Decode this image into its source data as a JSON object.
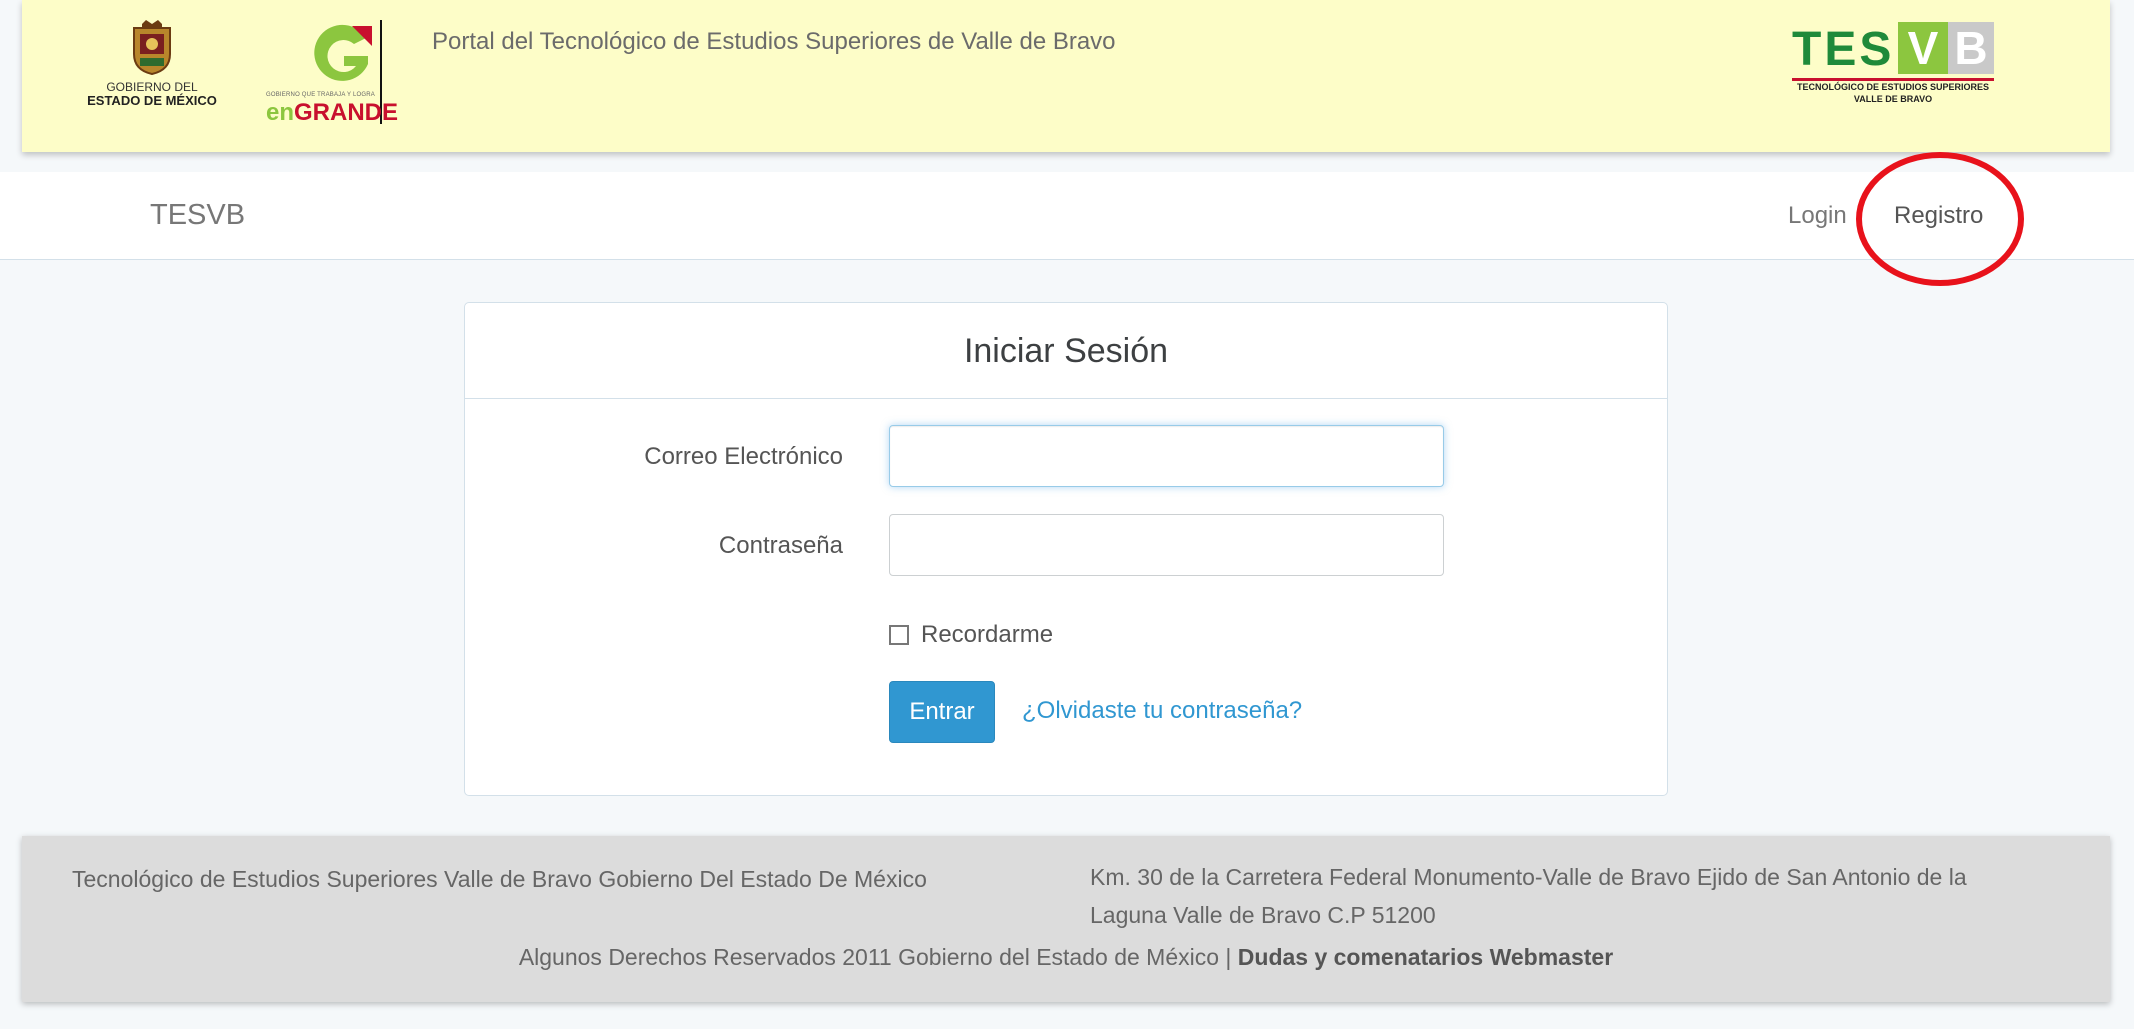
{
  "header": {
    "gob_logo": {
      "line1": "GOBIERNO DEL",
      "line2": "ESTADO DE MÉXICO"
    },
    "engrande_logo": {
      "tiny": "GOBIERNO QUE TRABAJA Y LOGRA",
      "en": "en",
      "grande": "GRANDE"
    },
    "portal_title": "Portal del Tecnológico de Estudios Superiores de Valle de Bravo",
    "tesvb_logo": {
      "tes": "TES",
      "v": "V",
      "b": "B",
      "sub1": "TECNOLÓGICO DE ESTUDIOS SUPERIORES",
      "sub2": "VALLE DE BRAVO"
    }
  },
  "navbar": {
    "brand": "TESVB",
    "login": "Login",
    "registro": "Registro",
    "highlight_color": "#e8121b"
  },
  "login_form": {
    "title": "Iniciar Sesión",
    "email_label": "Correo Electrónico",
    "email_value": "",
    "password_label": "Contraseña",
    "password_value": "",
    "remember_label": "Recordarme",
    "remember_checked": false,
    "submit_label": "Entrar",
    "forgot_link": "¿Olvidaste tu contraseña?",
    "accent_color": "#3097d1"
  },
  "footer": {
    "left": "Tecnológico de Estudios Superiores Valle de Bravo Gobierno Del Estado De México",
    "address": "Km. 30 de la Carretera Federal Monumento-Valle de Bravo Ejido de San Antonio de la Laguna Valle de Bravo C.P 51200",
    "rights": "Algunos Derechos Reservados 2011 Gobierno del Estado de México |",
    "webmaster_link": "Dudas y comenatarios Webmaster"
  }
}
